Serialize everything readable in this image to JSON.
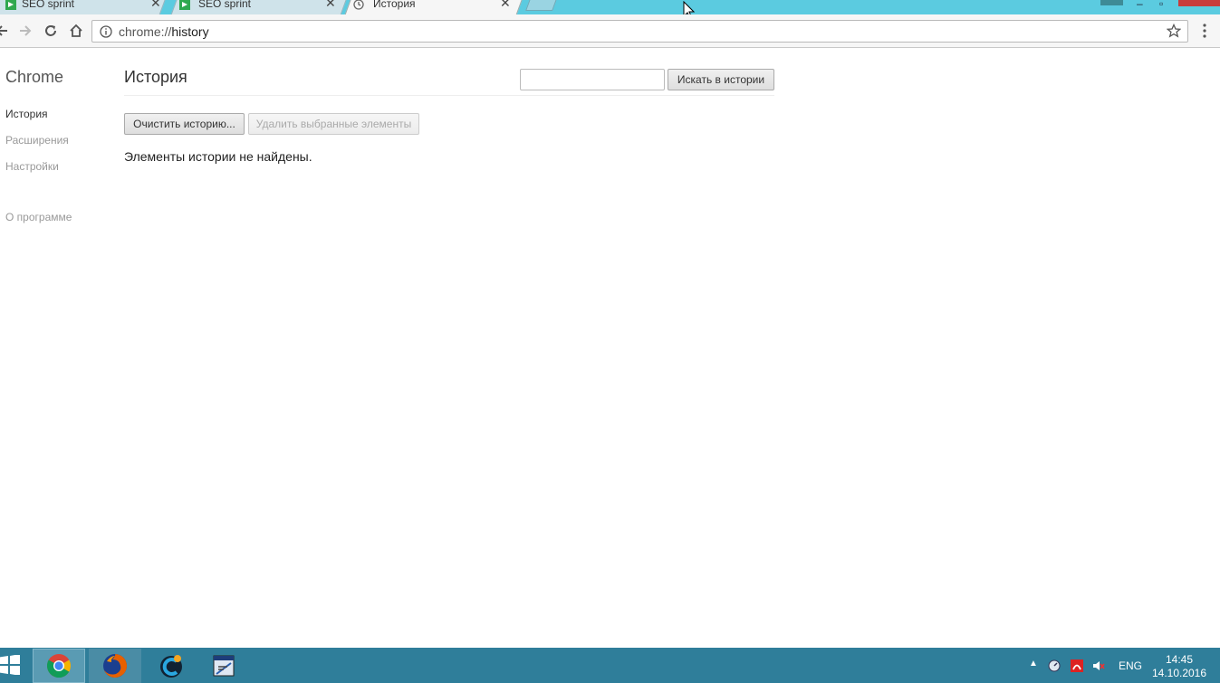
{
  "browser": {
    "tabs": [
      {
        "title": "SEO sprint",
        "icon": "seo-sprint-favicon"
      },
      {
        "title": "SEO sprint",
        "icon": "seo-sprint-favicon"
      },
      {
        "title": "История",
        "icon": "history-clock-icon",
        "active": true
      }
    ],
    "address": {
      "scheme": "chrome://",
      "path": "history"
    }
  },
  "sidebar": {
    "brand": "Chrome",
    "items": [
      {
        "label": "История",
        "selected": true
      },
      {
        "label": "Расширения"
      },
      {
        "label": "Настройки"
      },
      {
        "label": "О программе"
      }
    ]
  },
  "main": {
    "title": "История",
    "search_value": "",
    "search_button": "Искать в истории",
    "clear_button": "Очистить историю...",
    "delete_button": "Удалить выбранные элементы",
    "empty_message": "Элементы истории не найдены."
  },
  "taskbar": {
    "apps": [
      "chrome",
      "firefox",
      "ccleaner",
      "app-window"
    ],
    "language": "ENG",
    "time": "14:45",
    "date": "14.10.2016"
  },
  "colors": {
    "tabstrip": "#5bcbe0",
    "taskbar": "#2f7e9a",
    "close_button": "#c83c3c"
  }
}
